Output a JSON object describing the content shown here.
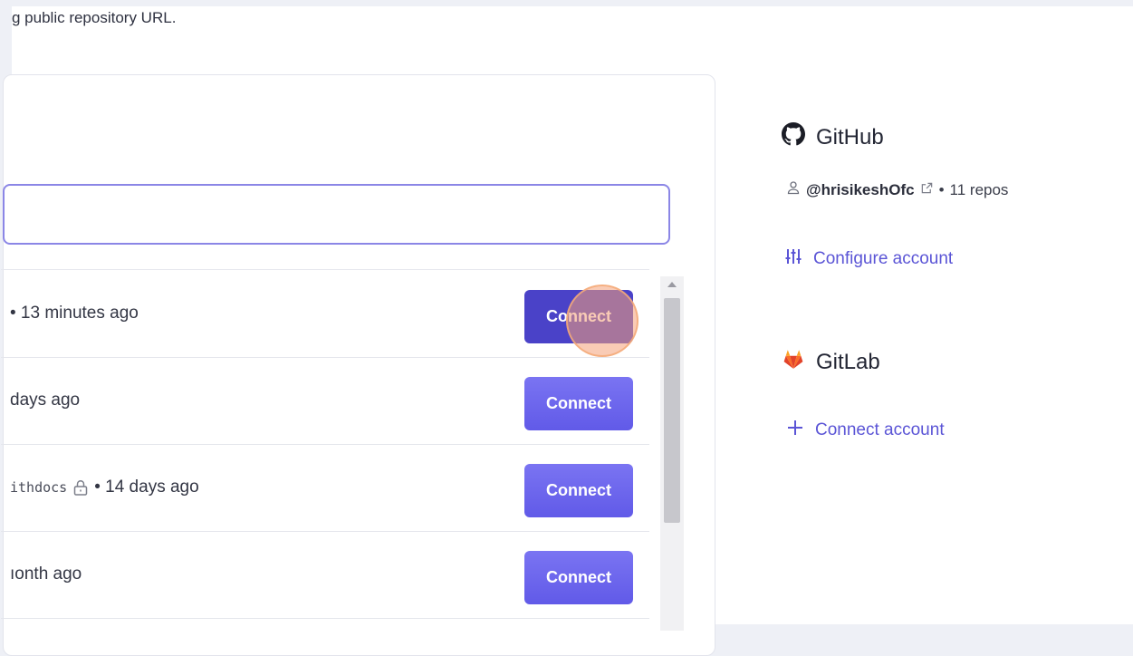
{
  "intro_text": "g public repository URL.",
  "repos": [
    {
      "meta": "• 13 minutes ago",
      "repo_name": "",
      "button": "Connect",
      "active": true
    },
    {
      "meta": "days ago",
      "repo_name": "",
      "button": "Connect",
      "active": false
    },
    {
      "meta": "• 14 days ago",
      "repo_name": "ithdocs",
      "button": "Connect",
      "active": false,
      "private": true
    },
    {
      "meta": "ıonth ago",
      "repo_name": "",
      "button": "Connect",
      "active": false
    }
  ],
  "github": {
    "title": "GitHub",
    "icon": "github-icon",
    "username": "@hrisikeshOfc",
    "separator": "•",
    "repos_count": "11 repos",
    "configure_label": "Configure account"
  },
  "gitlab": {
    "title": "GitLab",
    "icon": "gitlab-icon",
    "connect_label": "Connect account"
  },
  "colors": {
    "accent": "#615ae8",
    "accent_dark": "#4a42c8",
    "link": "#5b55d6",
    "gitlab": "#e2432a"
  }
}
